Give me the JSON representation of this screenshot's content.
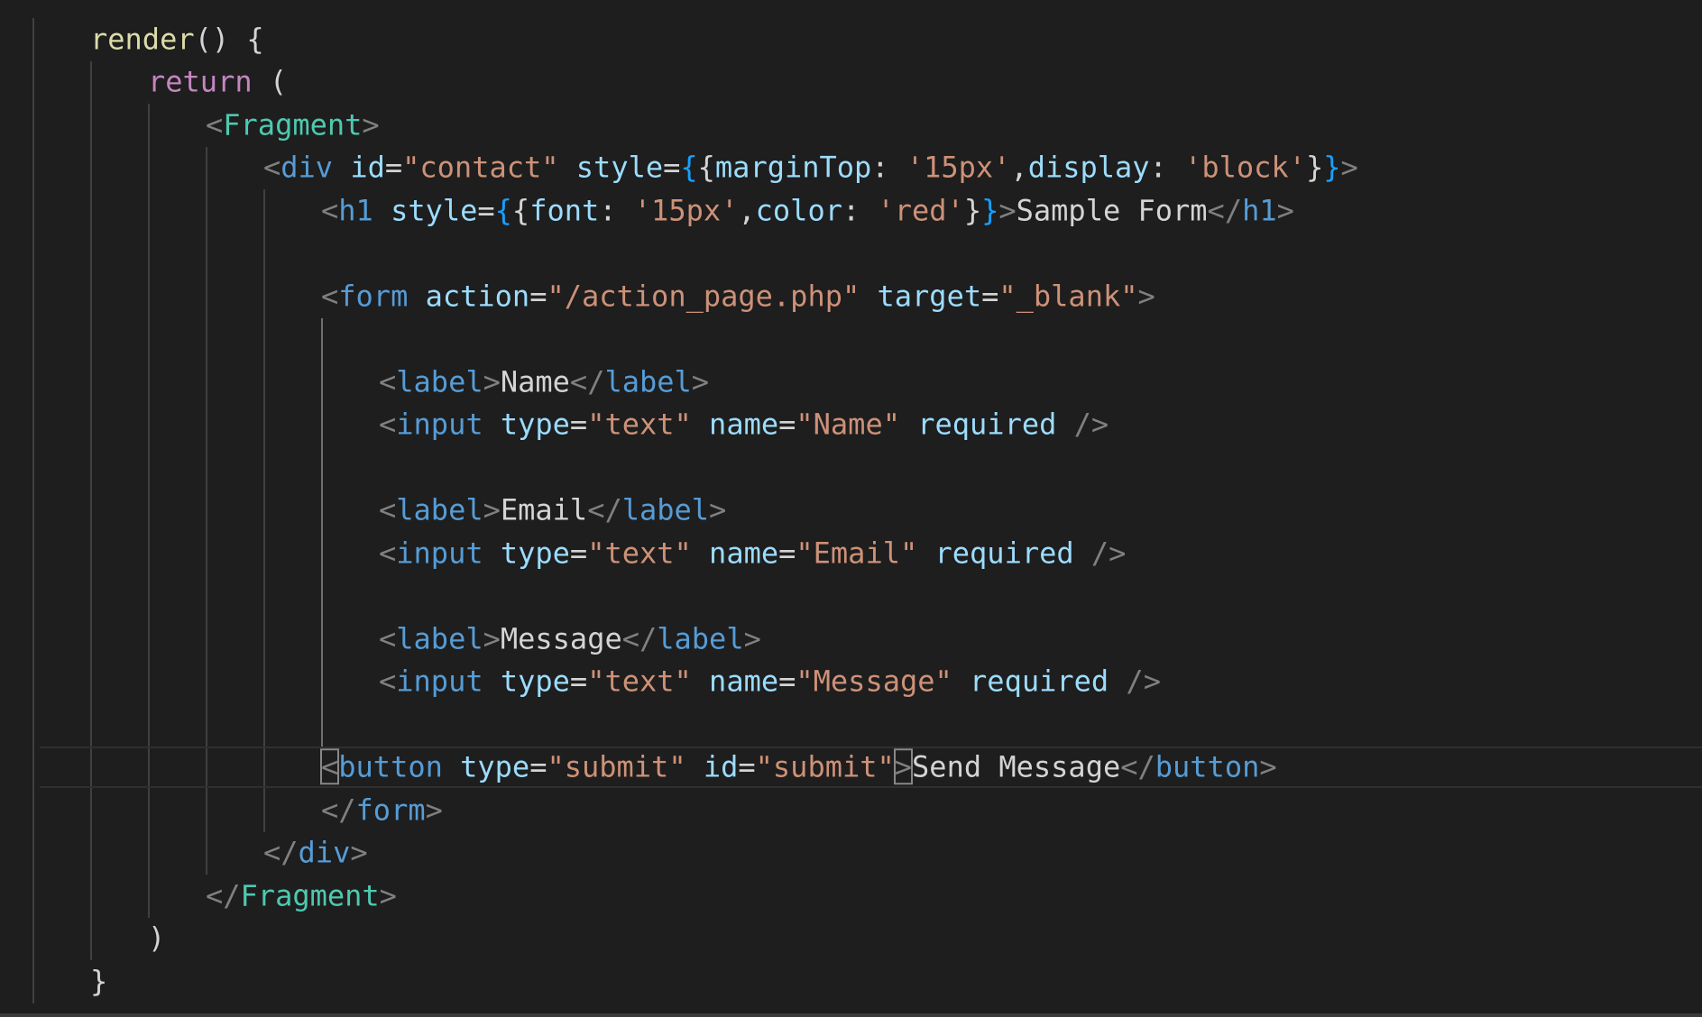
{
  "editor": {
    "language": "javascript-react",
    "colors": {
      "background": "#1e1e1e",
      "function": "#dcdcaa",
      "keyword": "#c586c0",
      "tag": "#569cd6",
      "component": "#4ec9b0",
      "attribute": "#9cdcfe",
      "string": "#ce9178",
      "text": "#d4d4d4",
      "angle": "#808080"
    },
    "current_line_index": 17,
    "lines": [
      [
        {
          "t": "render",
          "c": "t-fn"
        },
        {
          "t": "() {",
          "c": "t-punc"
        }
      ],
      [
        {
          "t": "return",
          "c": "t-kw"
        },
        {
          "t": " (",
          "c": "t-punc"
        }
      ],
      [
        {
          "t": "<",
          "c": "t-angle"
        },
        {
          "t": "Fragment",
          "c": "t-comp"
        },
        {
          "t": ">",
          "c": "t-angle"
        }
      ],
      [
        {
          "t": "<",
          "c": "t-angle"
        },
        {
          "t": "div",
          "c": "t-tag"
        },
        {
          "t": " ",
          "c": "t-punc"
        },
        {
          "t": "id",
          "c": "t-attr"
        },
        {
          "t": "=",
          "c": "t-punc"
        },
        {
          "t": "\"contact\"",
          "c": "t-str"
        },
        {
          "t": " ",
          "c": "t-punc"
        },
        {
          "t": "style",
          "c": "t-attr"
        },
        {
          "t": "=",
          "c": "t-punc"
        },
        {
          "t": "{",
          "c": "t-brace2"
        },
        {
          "t": "{",
          "c": "t-text"
        },
        {
          "t": "marginTop",
          "c": "t-attr"
        },
        {
          "t": ": ",
          "c": "t-punc"
        },
        {
          "t": "'15px'",
          "c": "t-str"
        },
        {
          "t": ",",
          "c": "t-punc"
        },
        {
          "t": "display",
          "c": "t-attr"
        },
        {
          "t": ": ",
          "c": "t-punc"
        },
        {
          "t": "'block'",
          "c": "t-str"
        },
        {
          "t": "}",
          "c": "t-text"
        },
        {
          "t": "}",
          "c": "t-brace2"
        },
        {
          "t": ">",
          "c": "t-angle"
        }
      ],
      [
        {
          "t": "<",
          "c": "t-angle"
        },
        {
          "t": "h1",
          "c": "t-tag"
        },
        {
          "t": " ",
          "c": "t-punc"
        },
        {
          "t": "style",
          "c": "t-attr"
        },
        {
          "t": "=",
          "c": "t-punc"
        },
        {
          "t": "{",
          "c": "t-brace2"
        },
        {
          "t": "{",
          "c": "t-text"
        },
        {
          "t": "font",
          "c": "t-attr"
        },
        {
          "t": ": ",
          "c": "t-punc"
        },
        {
          "t": "'15px'",
          "c": "t-str"
        },
        {
          "t": ",",
          "c": "t-punc"
        },
        {
          "t": "color",
          "c": "t-attr"
        },
        {
          "t": ": ",
          "c": "t-punc"
        },
        {
          "t": "'red'",
          "c": "t-str"
        },
        {
          "t": "}",
          "c": "t-text"
        },
        {
          "t": "}",
          "c": "t-brace2"
        },
        {
          "t": ">",
          "c": "t-angle"
        },
        {
          "t": "Sample Form",
          "c": "t-text"
        },
        {
          "t": "</",
          "c": "t-angle"
        },
        {
          "t": "h1",
          "c": "t-tag"
        },
        {
          "t": ">",
          "c": "t-angle"
        }
      ],
      [],
      [
        {
          "t": "<",
          "c": "t-angle"
        },
        {
          "t": "form",
          "c": "t-tag"
        },
        {
          "t": " ",
          "c": "t-punc"
        },
        {
          "t": "action",
          "c": "t-attr"
        },
        {
          "t": "=",
          "c": "t-punc"
        },
        {
          "t": "\"/action_page.php\"",
          "c": "t-str"
        },
        {
          "t": " ",
          "c": "t-punc"
        },
        {
          "t": "target",
          "c": "t-attr"
        },
        {
          "t": "=",
          "c": "t-punc"
        },
        {
          "t": "\"_blank\"",
          "c": "t-str"
        },
        {
          "t": ">",
          "c": "t-angle"
        }
      ],
      [],
      [
        {
          "t": "<",
          "c": "t-angle"
        },
        {
          "t": "label",
          "c": "t-tag"
        },
        {
          "t": ">",
          "c": "t-angle"
        },
        {
          "t": "Name",
          "c": "t-text"
        },
        {
          "t": "</",
          "c": "t-angle"
        },
        {
          "t": "label",
          "c": "t-tag"
        },
        {
          "t": ">",
          "c": "t-angle"
        }
      ],
      [
        {
          "t": "<",
          "c": "t-angle"
        },
        {
          "t": "input",
          "c": "t-tag"
        },
        {
          "t": " ",
          "c": "t-punc"
        },
        {
          "t": "type",
          "c": "t-attr"
        },
        {
          "t": "=",
          "c": "t-punc"
        },
        {
          "t": "\"text\"",
          "c": "t-str"
        },
        {
          "t": " ",
          "c": "t-punc"
        },
        {
          "t": "name",
          "c": "t-attr"
        },
        {
          "t": "=",
          "c": "t-punc"
        },
        {
          "t": "\"Name\"",
          "c": "t-str"
        },
        {
          "t": " ",
          "c": "t-punc"
        },
        {
          "t": "required",
          "c": "t-attr"
        },
        {
          "t": " ",
          "c": "t-punc"
        },
        {
          "t": "/>",
          "c": "t-angle"
        }
      ],
      [],
      [
        {
          "t": "<",
          "c": "t-angle"
        },
        {
          "t": "label",
          "c": "t-tag"
        },
        {
          "t": ">",
          "c": "t-angle"
        },
        {
          "t": "Email",
          "c": "t-text"
        },
        {
          "t": "</",
          "c": "t-angle"
        },
        {
          "t": "label",
          "c": "t-tag"
        },
        {
          "t": ">",
          "c": "t-angle"
        }
      ],
      [
        {
          "t": "<",
          "c": "t-angle"
        },
        {
          "t": "input",
          "c": "t-tag"
        },
        {
          "t": " ",
          "c": "t-punc"
        },
        {
          "t": "type",
          "c": "t-attr"
        },
        {
          "t": "=",
          "c": "t-punc"
        },
        {
          "t": "\"text\"",
          "c": "t-str"
        },
        {
          "t": " ",
          "c": "t-punc"
        },
        {
          "t": "name",
          "c": "t-attr"
        },
        {
          "t": "=",
          "c": "t-punc"
        },
        {
          "t": "\"Email\"",
          "c": "t-str"
        },
        {
          "t": " ",
          "c": "t-punc"
        },
        {
          "t": "required",
          "c": "t-attr"
        },
        {
          "t": " ",
          "c": "t-punc"
        },
        {
          "t": "/>",
          "c": "t-angle"
        }
      ],
      [],
      [
        {
          "t": "<",
          "c": "t-angle"
        },
        {
          "t": "label",
          "c": "t-tag"
        },
        {
          "t": ">",
          "c": "t-angle"
        },
        {
          "t": "Message",
          "c": "t-text"
        },
        {
          "t": "</",
          "c": "t-angle"
        },
        {
          "t": "label",
          "c": "t-tag"
        },
        {
          "t": ">",
          "c": "t-angle"
        }
      ],
      [
        {
          "t": "<",
          "c": "t-angle"
        },
        {
          "t": "input",
          "c": "t-tag"
        },
        {
          "t": " ",
          "c": "t-punc"
        },
        {
          "t": "type",
          "c": "t-attr"
        },
        {
          "t": "=",
          "c": "t-punc"
        },
        {
          "t": "\"text\"",
          "c": "t-str"
        },
        {
          "t": " ",
          "c": "t-punc"
        },
        {
          "t": "name",
          "c": "t-attr"
        },
        {
          "t": "=",
          "c": "t-punc"
        },
        {
          "t": "\"Message\"",
          "c": "t-str"
        },
        {
          "t": " ",
          "c": "t-punc"
        },
        {
          "t": "required",
          "c": "t-attr"
        },
        {
          "t": " ",
          "c": "t-punc"
        },
        {
          "t": "/>",
          "c": "t-angle"
        }
      ],
      [],
      [
        {
          "t": "<",
          "c": "t-angle",
          "m": true
        },
        {
          "t": "button",
          "c": "t-tag"
        },
        {
          "t": " ",
          "c": "t-punc"
        },
        {
          "t": "type",
          "c": "t-attr"
        },
        {
          "t": "=",
          "c": "t-punc"
        },
        {
          "t": "\"submit\"",
          "c": "t-str"
        },
        {
          "t": " ",
          "c": "t-punc"
        },
        {
          "t": "id",
          "c": "t-attr"
        },
        {
          "t": "=",
          "c": "t-punc"
        },
        {
          "t": "\"submit\"",
          "c": "t-str"
        },
        {
          "t": ">",
          "c": "t-angle",
          "m": true
        },
        {
          "t": "Send Message",
          "c": "t-text"
        },
        {
          "t": "</",
          "c": "t-angle"
        },
        {
          "t": "button",
          "c": "t-tag"
        },
        {
          "t": ">",
          "c": "t-angle"
        }
      ],
      [
        {
          "t": "</",
          "c": "t-angle"
        },
        {
          "t": "form",
          "c": "t-tag"
        },
        {
          "t": ">",
          "c": "t-angle"
        }
      ],
      [
        {
          "t": "</",
          "c": "t-angle"
        },
        {
          "t": "div",
          "c": "t-tag"
        },
        {
          "t": ">",
          "c": "t-angle"
        }
      ],
      [
        {
          "t": "</",
          "c": "t-angle"
        },
        {
          "t": "Fragment",
          "c": "t-comp"
        },
        {
          "t": ">",
          "c": "t-angle"
        }
      ],
      [
        {
          "t": ")",
          "c": "t-punc"
        }
      ],
      [
        {
          "t": "}",
          "c": "t-punc"
        }
      ]
    ]
  }
}
